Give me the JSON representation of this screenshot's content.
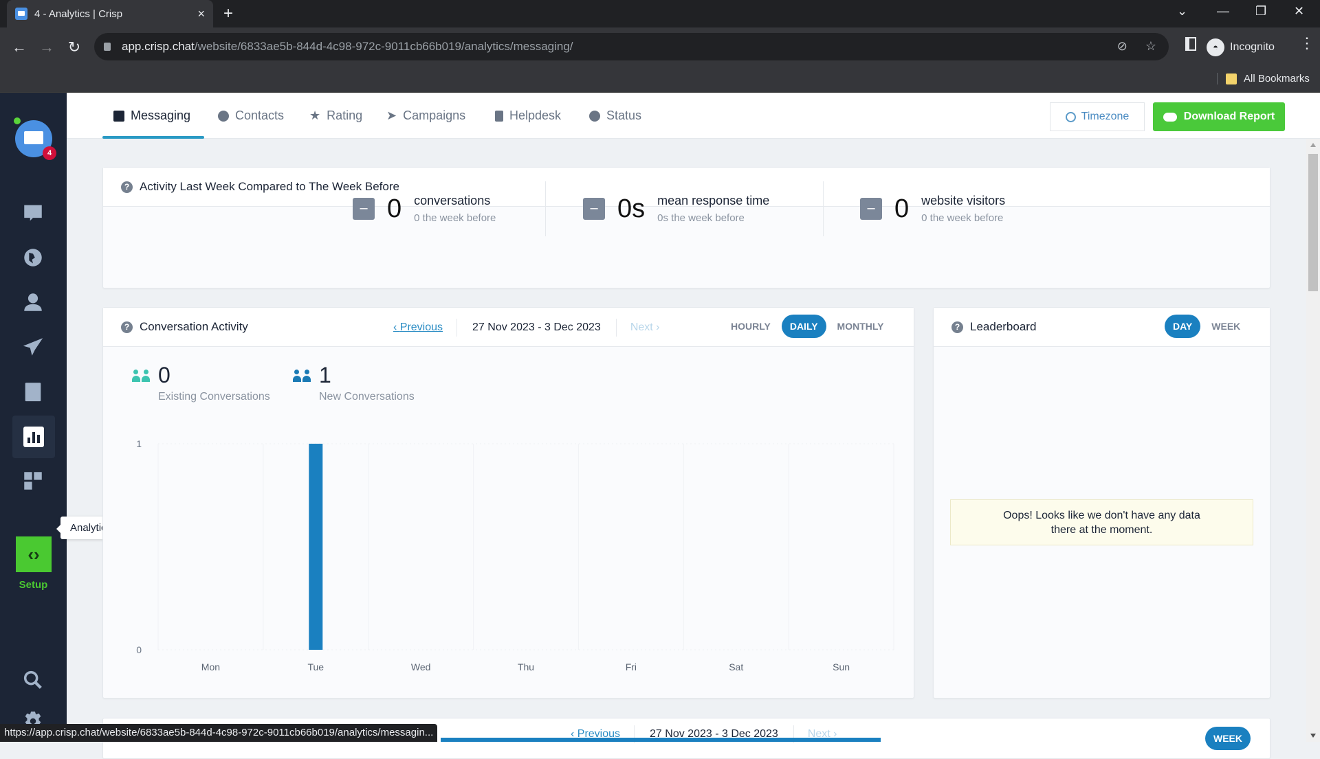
{
  "browser": {
    "tab_title": "4 - Analytics | Crisp",
    "url_host": "app.crisp.chat",
    "url_path": "/website/6833ae5b-844d-4c98-972c-9011cb66b019/analytics/messaging/",
    "profile_label": "Incognito",
    "bookmarks_label": "All Bookmarks",
    "status_url": "https://app.crisp.chat/website/6833ae5b-844d-4c98-972c-9011cb66b019/analytics/messagin..."
  },
  "sidebar": {
    "notification_count": "4",
    "tooltip": "Analytics",
    "setup_label": "Setup",
    "items": [
      {
        "name": "inbox",
        "icon": "chat-bubble-icon"
      },
      {
        "name": "visitors",
        "icon": "globe-icon"
      },
      {
        "name": "contacts",
        "icon": "user-icon"
      },
      {
        "name": "campaigns",
        "icon": "paper-plane-icon"
      },
      {
        "name": "helpdesk",
        "icon": "book-icon"
      },
      {
        "name": "analytics",
        "icon": "bar-chart-icon",
        "active": true
      },
      {
        "name": "plugins",
        "icon": "grid-icon"
      },
      {
        "name": "search",
        "icon": "search-icon"
      },
      {
        "name": "settings",
        "icon": "gear-icon"
      }
    ]
  },
  "nav": {
    "tabs": [
      {
        "label": "Messaging",
        "active": true
      },
      {
        "label": "Contacts"
      },
      {
        "label": "Rating"
      },
      {
        "label": "Campaigns"
      },
      {
        "label": "Helpdesk"
      },
      {
        "label": "Status"
      }
    ],
    "timezone_label": "Timezone",
    "download_label": "Download Report"
  },
  "activity": {
    "title": "Activity Last Week Compared to The Week Before",
    "stats": [
      {
        "value": "0",
        "label": "conversations",
        "sub": "0 the week before"
      },
      {
        "value": "0s",
        "label": "mean response time",
        "sub": "0s the week before"
      },
      {
        "value": "0",
        "label": "website visitors",
        "sub": "0 the week before"
      }
    ]
  },
  "conversation_activity": {
    "title": "Conversation Activity",
    "previous_label": "Previous",
    "range": "27 Nov 2023 - 3 Dec 2023",
    "next_label": "Next",
    "granularity": [
      "HOURLY",
      "DAILY",
      "MONTHLY"
    ],
    "selected_granularity": "DAILY",
    "existing_value": "0",
    "existing_label": "Existing Conversations",
    "new_value": "1",
    "new_label": "New Conversations"
  },
  "leaderboard": {
    "title": "Leaderboard",
    "periods": [
      "DAY",
      "WEEK"
    ],
    "selected": "DAY",
    "empty_line1": "Oops! Looks like we don't have any data",
    "empty_line2": "there at the moment."
  },
  "bottom_card": {
    "previous_label": "Previous",
    "range": "27 Nov 2023 - 3 Dec 2023",
    "next_label": "Next",
    "period_label": "WEEK"
  },
  "colors": {
    "accent": "#1a80c0",
    "green": "#4ac93a",
    "sidebar": "#1c2536"
  },
  "chart_data": {
    "type": "bar",
    "title": "Conversation Activity",
    "categories": [
      "Mon",
      "Tue",
      "Wed",
      "Thu",
      "Fri",
      "Sat",
      "Sun"
    ],
    "values": [
      0,
      1,
      0,
      0,
      0,
      0,
      0
    ],
    "yticks": [
      0,
      1
    ],
    "ylim": [
      0,
      1
    ],
    "xlabel": "",
    "ylabel": "",
    "grid": true,
    "color": "#1a80c0"
  }
}
